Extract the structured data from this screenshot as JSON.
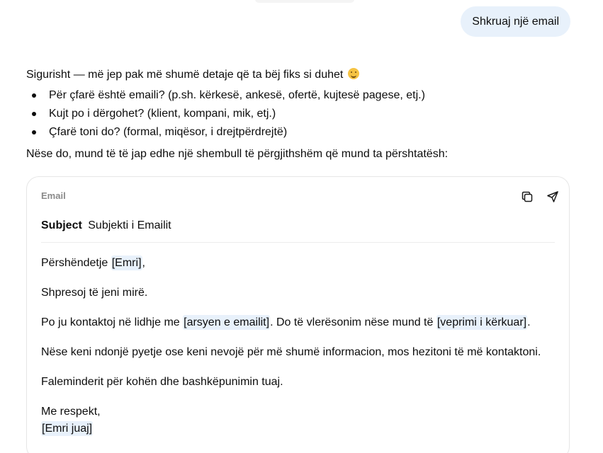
{
  "user_message": "Shkruaj një email",
  "reply": {
    "intro": "Sigurisht — më jep pak më shumë detaje që ta bëj fiks si duhet",
    "intro_emoji": "smiling-face-emoji",
    "bullets": [
      "Për çfarë është emaili? (p.sh. kërkesë, ankesë, ofertë, kujtesë pagese, etj.)",
      "Kujt po i dërgohet? (klient, kompani, mik, etj.)",
      "Çfarë toni do? (formal, miqësor, i drejtpërdrejtë)"
    ],
    "outro": "Nëse do, mund të të jap edhe një shembull të përgjithshëm që mund ta përshtatësh:"
  },
  "email_card": {
    "label": "Email",
    "copy_icon": "copy-icon",
    "send_icon": "send-icon",
    "subject_label": "Subject",
    "subject_value": "Subjekti i Emailit",
    "greeting_prefix": "Përshëndetje ",
    "greeting_placeholder": "[Emri]",
    "greeting_suffix": ",",
    "line2": "Shpresoj të jeni mirë.",
    "line3_part1": "Po ju kontaktoj në lidhje me ",
    "line3_placeholder1": "[arsyen e emailit]",
    "line3_part2": ". Do të vlerësonim nëse mund të ",
    "line3_placeholder2": "[veprimi i kërkuar]",
    "line3_part3": ".",
    "line4": "Nëse keni ndonjë pyetje ose keni nevojë për më shumë informacion, mos hezitoni të më kontaktoni.",
    "line5": "Faleminderit për kohën dhe bashkëpunimin tuaj.",
    "closing": "Me respekt,",
    "signature_placeholder": "[Emri juaj]"
  },
  "colors": {
    "user_bubble_bg": "#e8f1fb",
    "placeholder_bg": "#e8f1fb",
    "card_border": "#e6e6e6",
    "muted_label": "#8a8a8a"
  }
}
